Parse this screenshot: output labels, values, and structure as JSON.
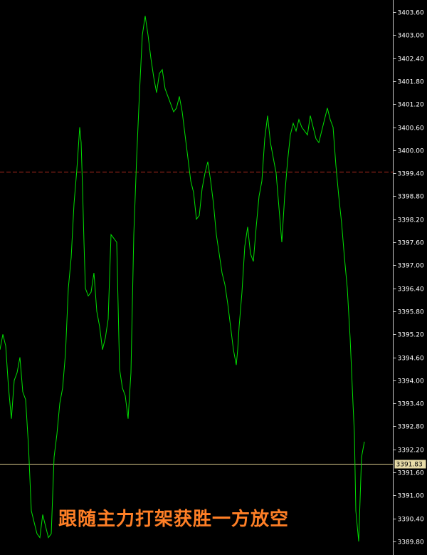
{
  "chart_data": {
    "type": "line",
    "ylim": [
      3389.6,
      3403.8
    ],
    "y_ticks": [
      "3403.60",
      "3403.00",
      "3402.40",
      "3401.80",
      "3401.20",
      "3400.60",
      "3400.00",
      "3399.40",
      "3398.80",
      "3398.20",
      "3397.60",
      "3397.00",
      "3396.40",
      "3395.80",
      "3395.20",
      "3394.60",
      "3394.00",
      "3393.40",
      "3392.80",
      "3392.20",
      "3391.60",
      "3391.00",
      "3390.40",
      "3389.80"
    ],
    "reference_level": 3399.44,
    "current_price": 3391.83,
    "current_price_label": "3391.83",
    "caption": "跟随主力打架获胜一方放空",
    "series": [
      {
        "x": [
          0,
          4,
          8,
          12,
          16,
          20,
          24,
          28,
          32,
          36,
          40,
          44,
          48,
          52,
          56,
          60,
          64,
          68,
          72,
          76,
          80,
          84,
          88,
          92,
          96,
          100,
          104,
          108,
          112,
          114,
          116,
          118,
          120,
          124,
          128,
          132,
          136,
          140,
          144,
          148,
          152,
          156,
          160,
          164,
          168,
          172,
          176,
          178,
          180,
          184,
          188,
          192,
          196,
          200,
          204,
          208,
          212,
          216,
          220,
          224,
          228,
          232,
          236,
          240,
          244,
          248,
          252,
          256,
          260,
          264,
          268,
          272,
          276,
          280,
          284,
          288,
          292,
          296,
          300,
          304,
          308,
          312,
          316,
          320,
          324,
          328,
          332,
          334,
          336,
          340,
          344,
          348,
          352,
          356,
          360,
          364,
          368,
          372,
          376,
          380,
          384,
          388,
          392,
          396,
          400,
          404,
          408,
          412,
          416,
          420,
          424,
          428,
          432,
          436,
          440,
          444,
          448,
          452,
          456,
          460,
          464,
          468,
          472,
          476,
          480,
          484,
          488,
          492,
          496,
          498,
          500,
          504,
          508,
          512
        ],
        "y": [
          3394.8,
          3395.2,
          3394.9,
          3393.8,
          3393.0,
          3394.0,
          3394.2,
          3394.6,
          3393.7,
          3393.5,
          3392.3,
          3390.6,
          3390.3,
          3390.0,
          3389.9,
          3390.5,
          3390.2,
          3389.9,
          3390.0,
          3392.0,
          3392.6,
          3393.4,
          3393.8,
          3394.7,
          3396.4,
          3397.2,
          3398.6,
          3399.5,
          3400.6,
          3400.2,
          3399.0,
          3397.6,
          3396.4,
          3396.2,
          3396.3,
          3396.8,
          3395.8,
          3395.4,
          3394.8,
          3395.1,
          3395.6,
          3397.8,
          3397.7,
          3397.6,
          3394.3,
          3393.8,
          3393.6,
          3393.3,
          3393.0,
          3394.2,
          3397.8,
          3399.8,
          3401.5,
          3403.0,
          3403.5,
          3403.0,
          3402.4,
          3401.9,
          3401.5,
          3402.0,
          3402.1,
          3401.6,
          3401.4,
          3401.2,
          3401.0,
          3401.1,
          3401.4,
          3401.0,
          3400.4,
          3399.8,
          3399.2,
          3398.9,
          3398.2,
          3398.3,
          3399.0,
          3399.4,
          3399.7,
          3399.2,
          3398.6,
          3397.8,
          3397.3,
          3396.8,
          3396.5,
          3396.0,
          3395.4,
          3394.8,
          3394.4,
          3394.8,
          3395.4,
          3396.3,
          3397.5,
          3398.0,
          3397.3,
          3397.1,
          3398.0,
          3398.8,
          3399.2,
          3400.3,
          3400.9,
          3400.2,
          3399.8,
          3399.4,
          3398.5,
          3397.6,
          3398.8,
          3399.7,
          3400.4,
          3400.7,
          3400.5,
          3400.8,
          3400.6,
          3400.5,
          3400.4,
          3400.9,
          3400.6,
          3400.3,
          3400.2,
          3400.5,
          3400.8,
          3401.1,
          3400.8,
          3400.6,
          3399.6,
          3398.8,
          3398.1,
          3397.2,
          3396.4,
          3395.1,
          3393.4,
          3392.6,
          3390.6,
          3389.8,
          3392.0,
          3392.4
        ]
      }
    ]
  }
}
